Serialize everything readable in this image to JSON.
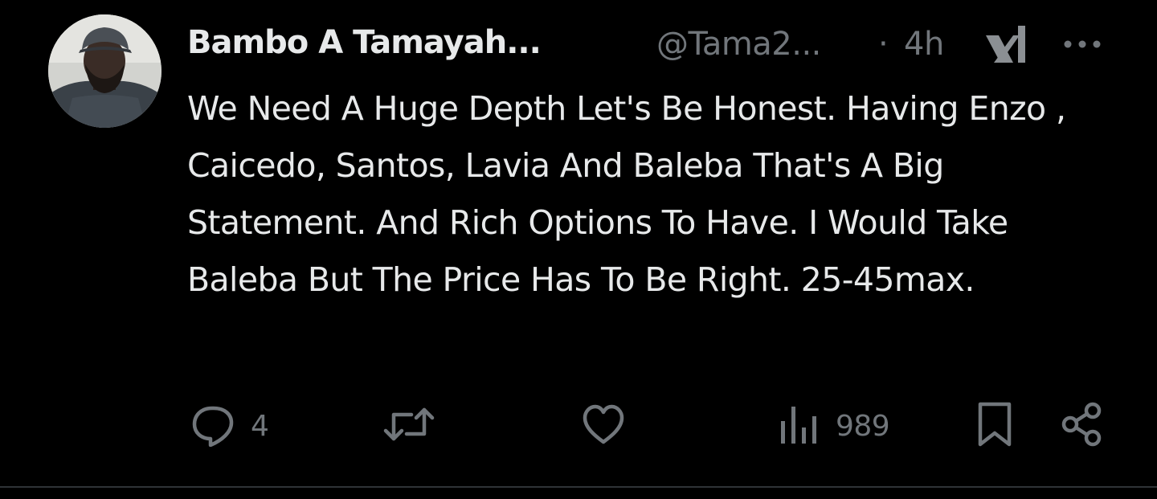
{
  "tweet": {
    "author_name": "Bambo A Tamayah...",
    "handle": "@Tama2...",
    "separator": "·",
    "time": "4h",
    "text": "We Need A Huge Depth Let's Be Honest. Having Enzo , Caicedo, Santos, Lavia And Baleba That's A Big Statement. And Rich Options To Have. I Would Take Baleba But The Price Has To Be Right. 25-45max."
  },
  "actions": {
    "replies": "4",
    "reposts": "",
    "likes": "",
    "views": "989"
  },
  "icons": {
    "avatar": "profile-photo",
    "grok": "grok-icon",
    "more": "more-icon",
    "reply": "reply-icon",
    "repost": "repost-icon",
    "like": "heart-icon",
    "views": "views-icon",
    "bookmark": "bookmark-icon",
    "share": "share-icon"
  },
  "colors": {
    "background": "#000000",
    "primary_text": "#e7e9ea",
    "secondary_text": "#71767b",
    "divider": "#2f3336"
  }
}
